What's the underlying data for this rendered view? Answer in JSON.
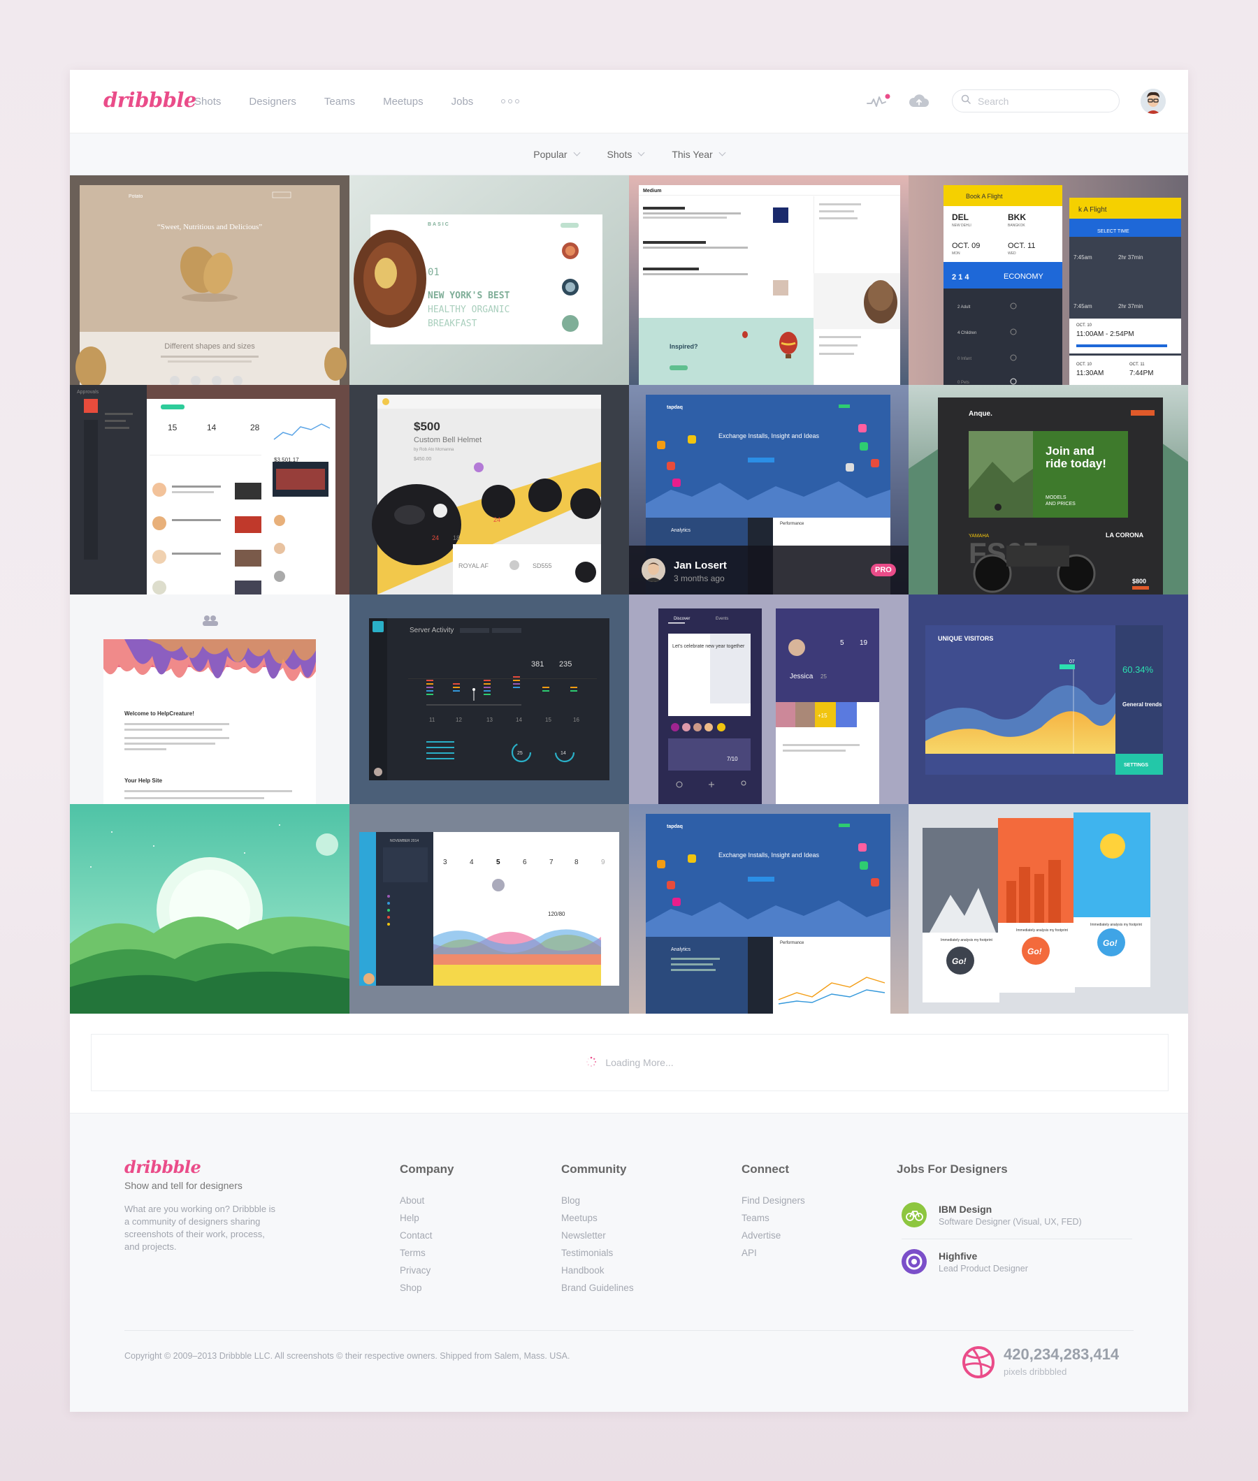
{
  "brand": {
    "logo_text": "dribbble",
    "accent": "#ea4c89"
  },
  "nav": {
    "links": [
      "Shots",
      "Designers",
      "Teams",
      "Meetups",
      "Jobs"
    ],
    "more_icon": "more-dots-icon",
    "search_placeholder": "Search"
  },
  "filters": {
    "popular": "Popular",
    "shots": "Shots",
    "period": "This Year"
  },
  "shots": {
    "s1": {
      "brand": "Potato",
      "headline": "“Sweet, Nutritious and Delicious”",
      "sub": "Different shapes and sizes"
    },
    "s2": {
      "brand": "BASIC",
      "num": "01",
      "line1": "NEW YORK'S BEST",
      "line2": "HEALTHY ORGANIC",
      "line3": "BREAKFAST"
    },
    "s3": {
      "brand": "Medium",
      "cta": "Inspired?"
    },
    "s4": {
      "title": "Book A Flight",
      "title2": "k A Flight",
      "from": "DEL",
      "from_city": "NEW DEHLI",
      "to": "BKK",
      "to_city": "BANGKOK",
      "date1": "OCT. 09",
      "day1": "MON",
      "date2": "OCT. 11",
      "day2": "WED",
      "pax": "2 1 4",
      "class": "ECONOMY",
      "select": "SELECT TIME",
      "time_a": "7:45am",
      "dur_a": "2hr 37min",
      "time_b": "7:45am",
      "dur_b": "2hr 37min",
      "oct10": "OCT. 10",
      "range1": "11:00AM - 2:54PM",
      "oct10b": "OCT. 10",
      "oct11b": "OCT. 11",
      "range2a": "11:30AM",
      "range2b": "7:44PM",
      "adult": "2 Adult",
      "children": "4 Children",
      "infant": "0 Infant",
      "pets": "0 Pets"
    },
    "s5": {
      "header": "Approvals",
      "stat1": "15",
      "stat2": "14",
      "stat3": "28",
      "money": "$3,501.17"
    },
    "s6": {
      "price": "$500",
      "name": "Custom Bell Helmet",
      "by": "by Rob Ato Mcmanna",
      "sub_price": "$450.00",
      "likes": "24",
      "comments": "18",
      "card1": "ROYAL AF",
      "card2": "SD555"
    },
    "s7": {
      "brand": "tapdaq",
      "headline": "Exchange Installs, Insight and Ideas",
      "section": "Analytics",
      "panel": "Performance",
      "owner_name": "Jan Losert",
      "owner_time": "3 months ago",
      "badge": "PRO"
    },
    "s8": {
      "brand": "Anque.",
      "headline1": "Join and",
      "headline2": "ride today!",
      "models": "MODELS",
      "prices": "AND PRICES",
      "make": "YAMAHA",
      "model": "FS65",
      "right": "LA CORONA",
      "price": "$800"
    },
    "s9": {
      "title": "Welcome to HelpCreature!",
      "sub": "Your Help Site"
    },
    "s10": {
      "title": "Server Activity",
      "v1": "381",
      "v2": "235",
      "ticks": [
        "11",
        "12",
        "13",
        "14",
        "15",
        "16"
      ],
      "g1": "25",
      "g2": "14"
    },
    "s11": {
      "tab1": "Discover",
      "tab2": "Events",
      "card": "Let's celebrate new year together",
      "name": "Jessica",
      "age": "25",
      "n1": "5",
      "n2": "19",
      "badge": "+15",
      "loc": "7/10"
    },
    "s12": {
      "title": "UNIQUE VISITORS",
      "rate": "60.34%",
      "trend": "General trends",
      "btn": "SETTINGS",
      "tip": "07"
    },
    "s14": {
      "month": "NOVEMBER 2014",
      "days": [
        "3",
        "4",
        "5",
        "6",
        "7",
        "8",
        "9"
      ],
      "metric": "120/80"
    },
    "s15": {
      "brand": "tapdaq",
      "headline": "Exchange Installs, Insight and Ideas",
      "section": "Analytics",
      "panel": "Performance"
    },
    "s16": {
      "go": "Go!",
      "caption": "Immediately analysis my footprint"
    }
  },
  "loading": {
    "text": "Loading More..."
  },
  "footer": {
    "logo_text": "dribbble",
    "tagline": "Show and tell for designers",
    "about": "What are you working on? Dribbble is a community of designers sharing screenshots of their work, process, and projects.",
    "company": {
      "title": "Company",
      "links": [
        "About",
        "Help",
        "Contact",
        "Terms",
        "Privacy",
        "Shop"
      ]
    },
    "community": {
      "title": "Community",
      "links": [
        "Blog",
        "Meetups",
        "Newsletter",
        "Testimonials",
        "Handbook",
        "Brand Guidelines"
      ]
    },
    "connect": {
      "title": "Connect",
      "links": [
        "Find Designers",
        "Teams",
        "Advertise",
        "API"
      ]
    },
    "jobs": {
      "title": "Jobs For Designers",
      "items": [
        {
          "company": "IBM Design",
          "role": "Software Designer (Visual, UX, FED)",
          "icon": "bike-icon",
          "color": "#8dc63f"
        },
        {
          "company": "Highfive",
          "role": "Lead Product Designer",
          "icon": "highfive-icon",
          "color": "#7b4fc9"
        }
      ]
    },
    "copyright": "Copyright © 2009–2013 Dribbble LLC. All screenshots © their respective owners. Shipped from Salem, Mass. USA.",
    "counter_value": "420,234,283,414",
    "counter_label": "pixels dribbbled"
  }
}
